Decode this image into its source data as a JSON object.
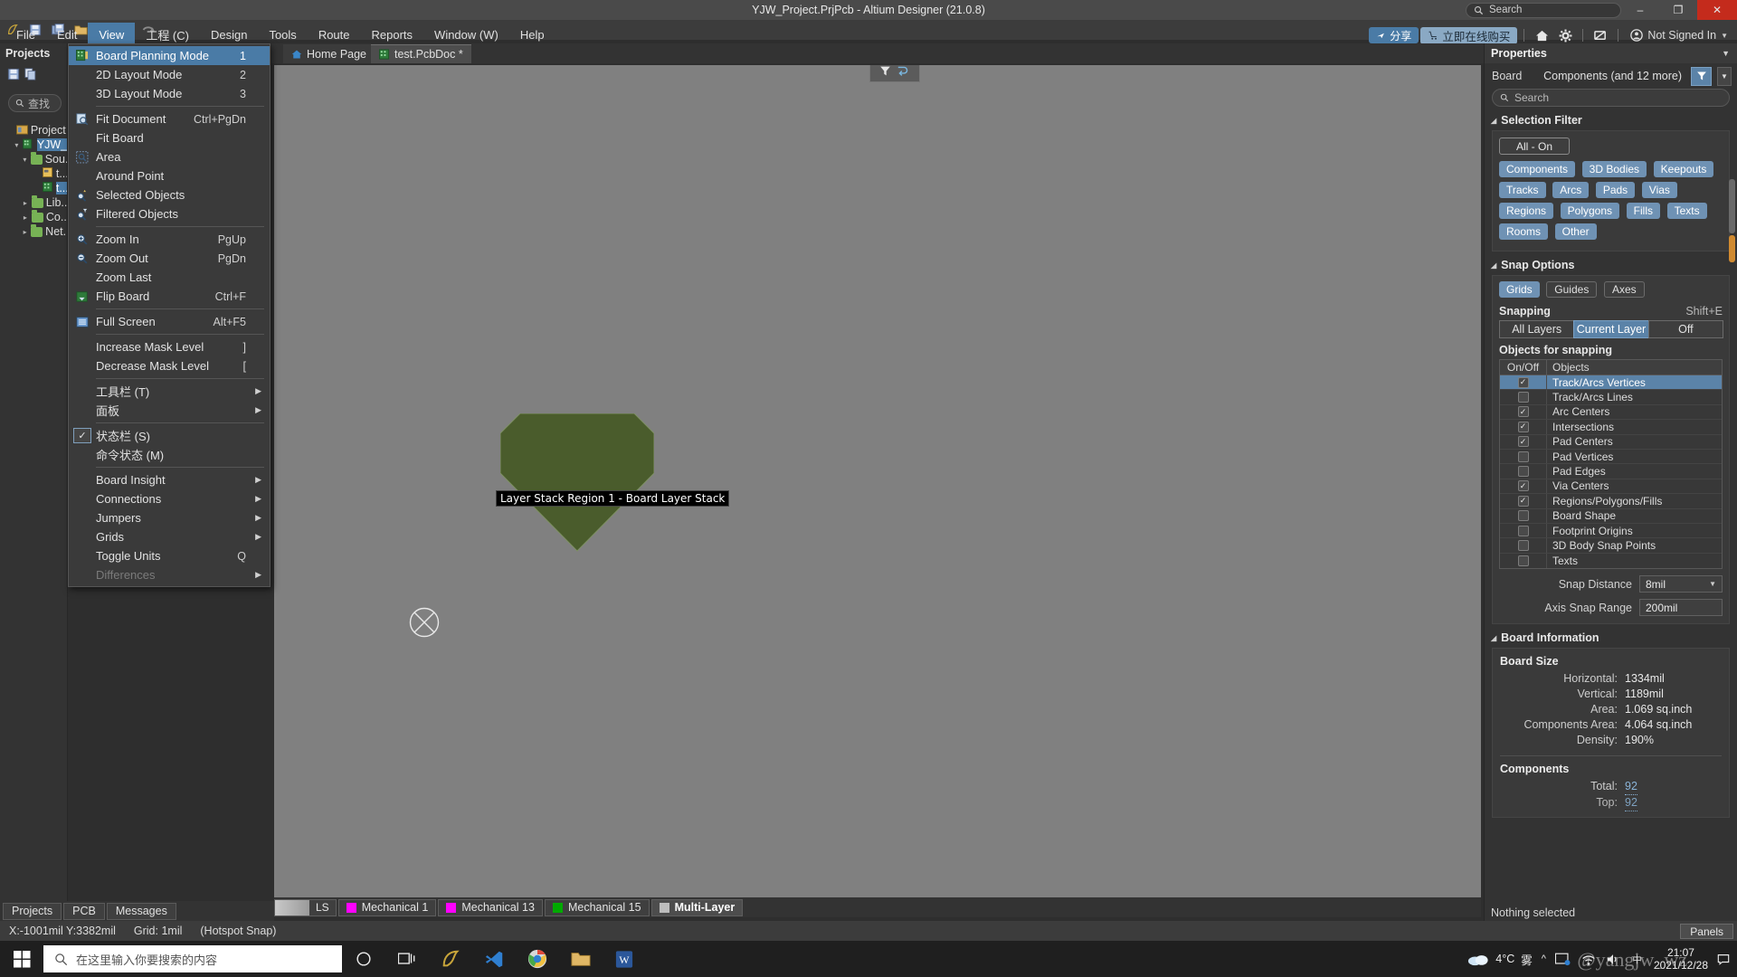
{
  "window": {
    "title": "YJW_Project.PrjPcb - Altium Designer (21.0.8)",
    "search_placeholder": "Search",
    "minimize": "–",
    "restore": "❐",
    "close": "✕"
  },
  "menubar": {
    "items": [
      {
        "label": "File",
        "mnemonic": "F"
      },
      {
        "label": "Edit",
        "mnemonic": "E"
      },
      {
        "label": "View",
        "mnemonic": "V",
        "active": true
      },
      {
        "label": "工程 (C)",
        "mnemonic": ""
      },
      {
        "label": "Design",
        "mnemonic": "D"
      },
      {
        "label": "Tools",
        "mnemonic": "T"
      },
      {
        "label": "Route",
        "mnemonic": "R"
      },
      {
        "label": "Reports",
        "mnemonic": "R"
      },
      {
        "label": "Window (W)",
        "mnemonic": ""
      },
      {
        "label": "Help",
        "mnemonic": "H"
      }
    ],
    "share_label": "分享",
    "buy_label": "立即在线购买",
    "signin_label": "Not Signed In"
  },
  "view_menu": {
    "items": [
      {
        "label": "Board Planning Mode",
        "shortcut": "1",
        "icon": "board-planning-icon",
        "highlight": true
      },
      {
        "label": "2D Layout Mode",
        "shortcut": "2",
        "icon": ""
      },
      {
        "label": "3D Layout Mode",
        "shortcut": "3",
        "icon": ""
      },
      {
        "sep": true
      },
      {
        "label": "Fit Document",
        "shortcut": "Ctrl+PgDn",
        "icon": "fit-document-icon"
      },
      {
        "label": "Fit Board",
        "shortcut": "",
        "icon": ""
      },
      {
        "label": "Area",
        "shortcut": "",
        "icon": "zoom-area-icon"
      },
      {
        "label": "Around Point",
        "shortcut": "",
        "icon": ""
      },
      {
        "label": "Selected Objects",
        "shortcut": "",
        "icon": "zoom-selected-icon"
      },
      {
        "label": "Filtered Objects",
        "shortcut": "",
        "icon": "zoom-filtered-icon"
      },
      {
        "sep": true
      },
      {
        "label": "Zoom In",
        "shortcut": "PgUp",
        "icon": "zoom-in-icon"
      },
      {
        "label": "Zoom Out",
        "shortcut": "PgDn",
        "icon": "zoom-out-icon"
      },
      {
        "label": "Zoom Last",
        "shortcut": "",
        "icon": ""
      },
      {
        "label": "Flip Board",
        "shortcut": "Ctrl+F",
        "icon": "flip-board-icon"
      },
      {
        "sep": true
      },
      {
        "label": "Full Screen",
        "shortcut": "Alt+F5",
        "icon": "full-screen-icon"
      },
      {
        "sep": true
      },
      {
        "label": "Increase Mask Level",
        "shortcut": "]",
        "icon": ""
      },
      {
        "label": "Decrease Mask Level",
        "shortcut": "[",
        "icon": ""
      },
      {
        "sep": true
      },
      {
        "label": "工具栏 (T)",
        "shortcut": "",
        "icon": "",
        "submenu": true
      },
      {
        "label": "面板",
        "shortcut": "",
        "icon": "",
        "submenu": true
      },
      {
        "sep": true
      },
      {
        "label": "状态栏 (S)",
        "shortcut": "",
        "icon": "",
        "checked": true
      },
      {
        "label": "命令状态 (M)",
        "shortcut": "",
        "icon": ""
      },
      {
        "sep": true
      },
      {
        "label": "Board Insight",
        "shortcut": "",
        "icon": "",
        "submenu": true
      },
      {
        "label": "Connections",
        "shortcut": "",
        "icon": "",
        "submenu": true
      },
      {
        "label": "Jumpers",
        "shortcut": "",
        "icon": "",
        "submenu": true
      },
      {
        "label": "Grids",
        "shortcut": "",
        "icon": "",
        "submenu": true
      },
      {
        "label": "Toggle Units",
        "shortcut": "Q",
        "icon": ""
      },
      {
        "label": "Differences",
        "shortcut": "",
        "icon": "",
        "submenu": true,
        "disabled": true
      }
    ]
  },
  "projects_panel": {
    "title": "Projects",
    "search_placeholder": "查找",
    "tree": [
      {
        "label": "Project ...",
        "indent": 0,
        "arrow": "",
        "icon": "workspace-icon"
      },
      {
        "label": "YJW_...",
        "indent": 1,
        "arrow": "▾",
        "icon": "project-icon",
        "selected": true
      },
      {
        "label": "Sou...",
        "indent": 2,
        "arrow": "▾",
        "icon": "folder-icon"
      },
      {
        "label": "t...",
        "indent": 3,
        "arrow": "",
        "icon": "sch-doc-icon"
      },
      {
        "label": "t...",
        "indent": 3,
        "arrow": "",
        "icon": "pcb-doc-icon",
        "selected": true
      },
      {
        "label": "Lib...",
        "indent": 2,
        "arrow": "▸",
        "icon": "folder-icon"
      },
      {
        "label": "Co...",
        "indent": 2,
        "arrow": "▸",
        "icon": "folder-icon"
      },
      {
        "label": "Net...",
        "indent": 2,
        "arrow": "▸",
        "icon": "folder-icon"
      }
    ]
  },
  "doc_tabs": [
    {
      "label": "Home Page",
      "icon": "home-icon",
      "active": false
    },
    {
      "label": "test.PcbDoc *",
      "icon": "pcb-doc-icon",
      "active": true
    }
  ],
  "canvas": {
    "tooltip": "Layer Stack Region 1 - Board Layer Stack",
    "board_fill": "#4a5c2c",
    "background": "#808080"
  },
  "properties": {
    "title": "Properties",
    "board_label": "Board",
    "board_value": "Components (and 12 more)",
    "search_placeholder": "Search",
    "selection_filter": {
      "title": "Selection Filter",
      "all_on": "All - On",
      "chips": [
        "Components",
        "3D Bodies",
        "Keepouts",
        "Tracks",
        "Arcs",
        "Pads",
        "Vias",
        "Regions",
        "Polygons",
        "Fills",
        "Texts",
        "Rooms",
        "Other"
      ]
    },
    "snap_options": {
      "title": "Snap Options",
      "modes": [
        {
          "label": "Grids",
          "on": true
        },
        {
          "label": "Guides",
          "on": false
        },
        {
          "label": "Axes",
          "on": false
        }
      ],
      "snapping_label": "Snapping",
      "snapping_shortcut": "Shift+E",
      "layers": [
        {
          "label": "All Layers",
          "on": false
        },
        {
          "label": "Current Layer",
          "on": true
        },
        {
          "label": "Off",
          "on": false
        }
      ],
      "objects_label": "Objects for snapping",
      "col_onoff": "On/Off",
      "col_objects": "Objects",
      "objects": [
        {
          "label": "Track/Arcs Vertices",
          "checked": true,
          "selected": true
        },
        {
          "label": "Track/Arcs Lines",
          "checked": false
        },
        {
          "label": "Arc Centers",
          "checked": true
        },
        {
          "label": "Intersections",
          "checked": true
        },
        {
          "label": "Pad Centers",
          "checked": true
        },
        {
          "label": "Pad Vertices",
          "checked": false
        },
        {
          "label": "Pad Edges",
          "checked": false
        },
        {
          "label": "Via Centers",
          "checked": true
        },
        {
          "label": "Regions/Polygons/Fills",
          "checked": true
        },
        {
          "label": "Board Shape",
          "checked": false
        },
        {
          "label": "Footprint Origins",
          "checked": false
        },
        {
          "label": "3D Body Snap Points",
          "checked": false
        },
        {
          "label": "Texts",
          "checked": false
        }
      ],
      "snap_distance_label": "Snap Distance",
      "snap_distance_value": "8mil",
      "axis_snap_label": "Axis Snap Range",
      "axis_snap_value": "200mil"
    },
    "board_information": {
      "title": "Board Information",
      "board_size_label": "Board Size",
      "rows": [
        {
          "key": "Horizontal:",
          "value": "1334mil"
        },
        {
          "key": "Vertical:",
          "value": "1189mil"
        },
        {
          "key": "Area:",
          "value": "1.069 sq.inch"
        },
        {
          "key": "Components Area:",
          "value": "4.064 sq.inch"
        },
        {
          "key": "Density:",
          "value": "190%"
        }
      ],
      "components_label": "Components",
      "component_rows": [
        {
          "key": "Total:",
          "value": "92",
          "link": true
        },
        {
          "key": "Top:",
          "value": "92",
          "link": true
        }
      ]
    },
    "status": "Nothing selected"
  },
  "panel_tabs": [
    {
      "label": "Projects"
    },
    {
      "label": "PCB"
    },
    {
      "label": "Messages"
    }
  ],
  "layer_tabs": {
    "ls_label": "LS",
    "layers": [
      {
        "label": "Mechanical 1",
        "color": "#ff00ff",
        "active": false
      },
      {
        "label": "Mechanical 13",
        "color": "#ff00ff",
        "active": false
      },
      {
        "label": "Mechanical 15",
        "color": "#00aa00",
        "active": false
      },
      {
        "label": "Multi-Layer",
        "color": "#bdbdbd",
        "active": true
      }
    ]
  },
  "statusbar": {
    "coords": "X:-1001mil Y:3382mil",
    "grid": "Grid: 1mil",
    "snap_mode": "(Hotspot Snap)",
    "panels_button": "Panels"
  },
  "taskbar": {
    "search_placeholder": "在这里输入你要搜索的内容",
    "weather_temp": "4°C",
    "weather_desc": "雾",
    "time": "21:07",
    "date": "2021/12/28",
    "watermark": "@yangjw_wz"
  }
}
